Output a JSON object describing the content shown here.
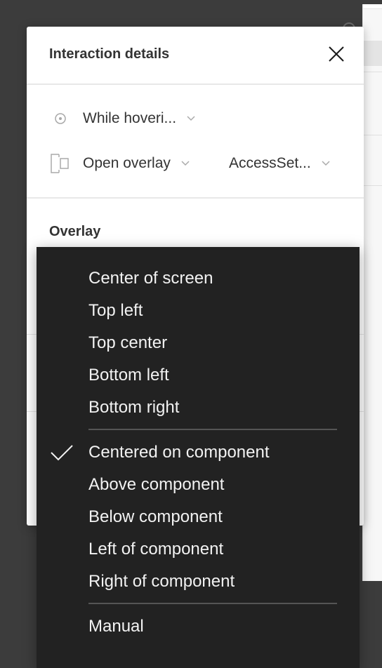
{
  "dialog": {
    "title": "Interaction details",
    "close_icon": "close-icon",
    "trigger": {
      "icon": "radio-target-icon",
      "value": "While hoveri...",
      "chevron_icon": "chevron-down-icon"
    },
    "action": {
      "icon": "overlay-frames-icon",
      "value": "Open overlay",
      "chevron_icon": "chevron-down-icon"
    },
    "destination": {
      "value": "AccessSet...",
      "chevron_icon": "chevron-down-icon"
    },
    "section_label": "Overlay"
  },
  "menu": {
    "groups": [
      {
        "items": [
          {
            "label": "Center of screen",
            "checked": false
          },
          {
            "label": "Top left",
            "checked": false
          },
          {
            "label": "Top center",
            "checked": false
          },
          {
            "label": "Bottom left",
            "checked": false
          },
          {
            "label": "Bottom right",
            "checked": false
          }
        ]
      },
      {
        "items": [
          {
            "label": "Centered on component",
            "checked": true
          },
          {
            "label": "Above component",
            "checked": false
          },
          {
            "label": "Below component",
            "checked": false
          },
          {
            "label": "Left of component",
            "checked": false
          },
          {
            "label": "Right of component",
            "checked": false
          }
        ]
      },
      {
        "items": [
          {
            "label": "Manual",
            "checked": false
          }
        ]
      }
    ],
    "selected": "Centered on component",
    "check_icon": "checkmark-icon"
  },
  "colors": {
    "menu_bg": "#222222",
    "menu_text": "#f2f2f2",
    "dialog_bg": "#ffffff",
    "text": "#333333",
    "backdrop": "#3c3c3c"
  }
}
